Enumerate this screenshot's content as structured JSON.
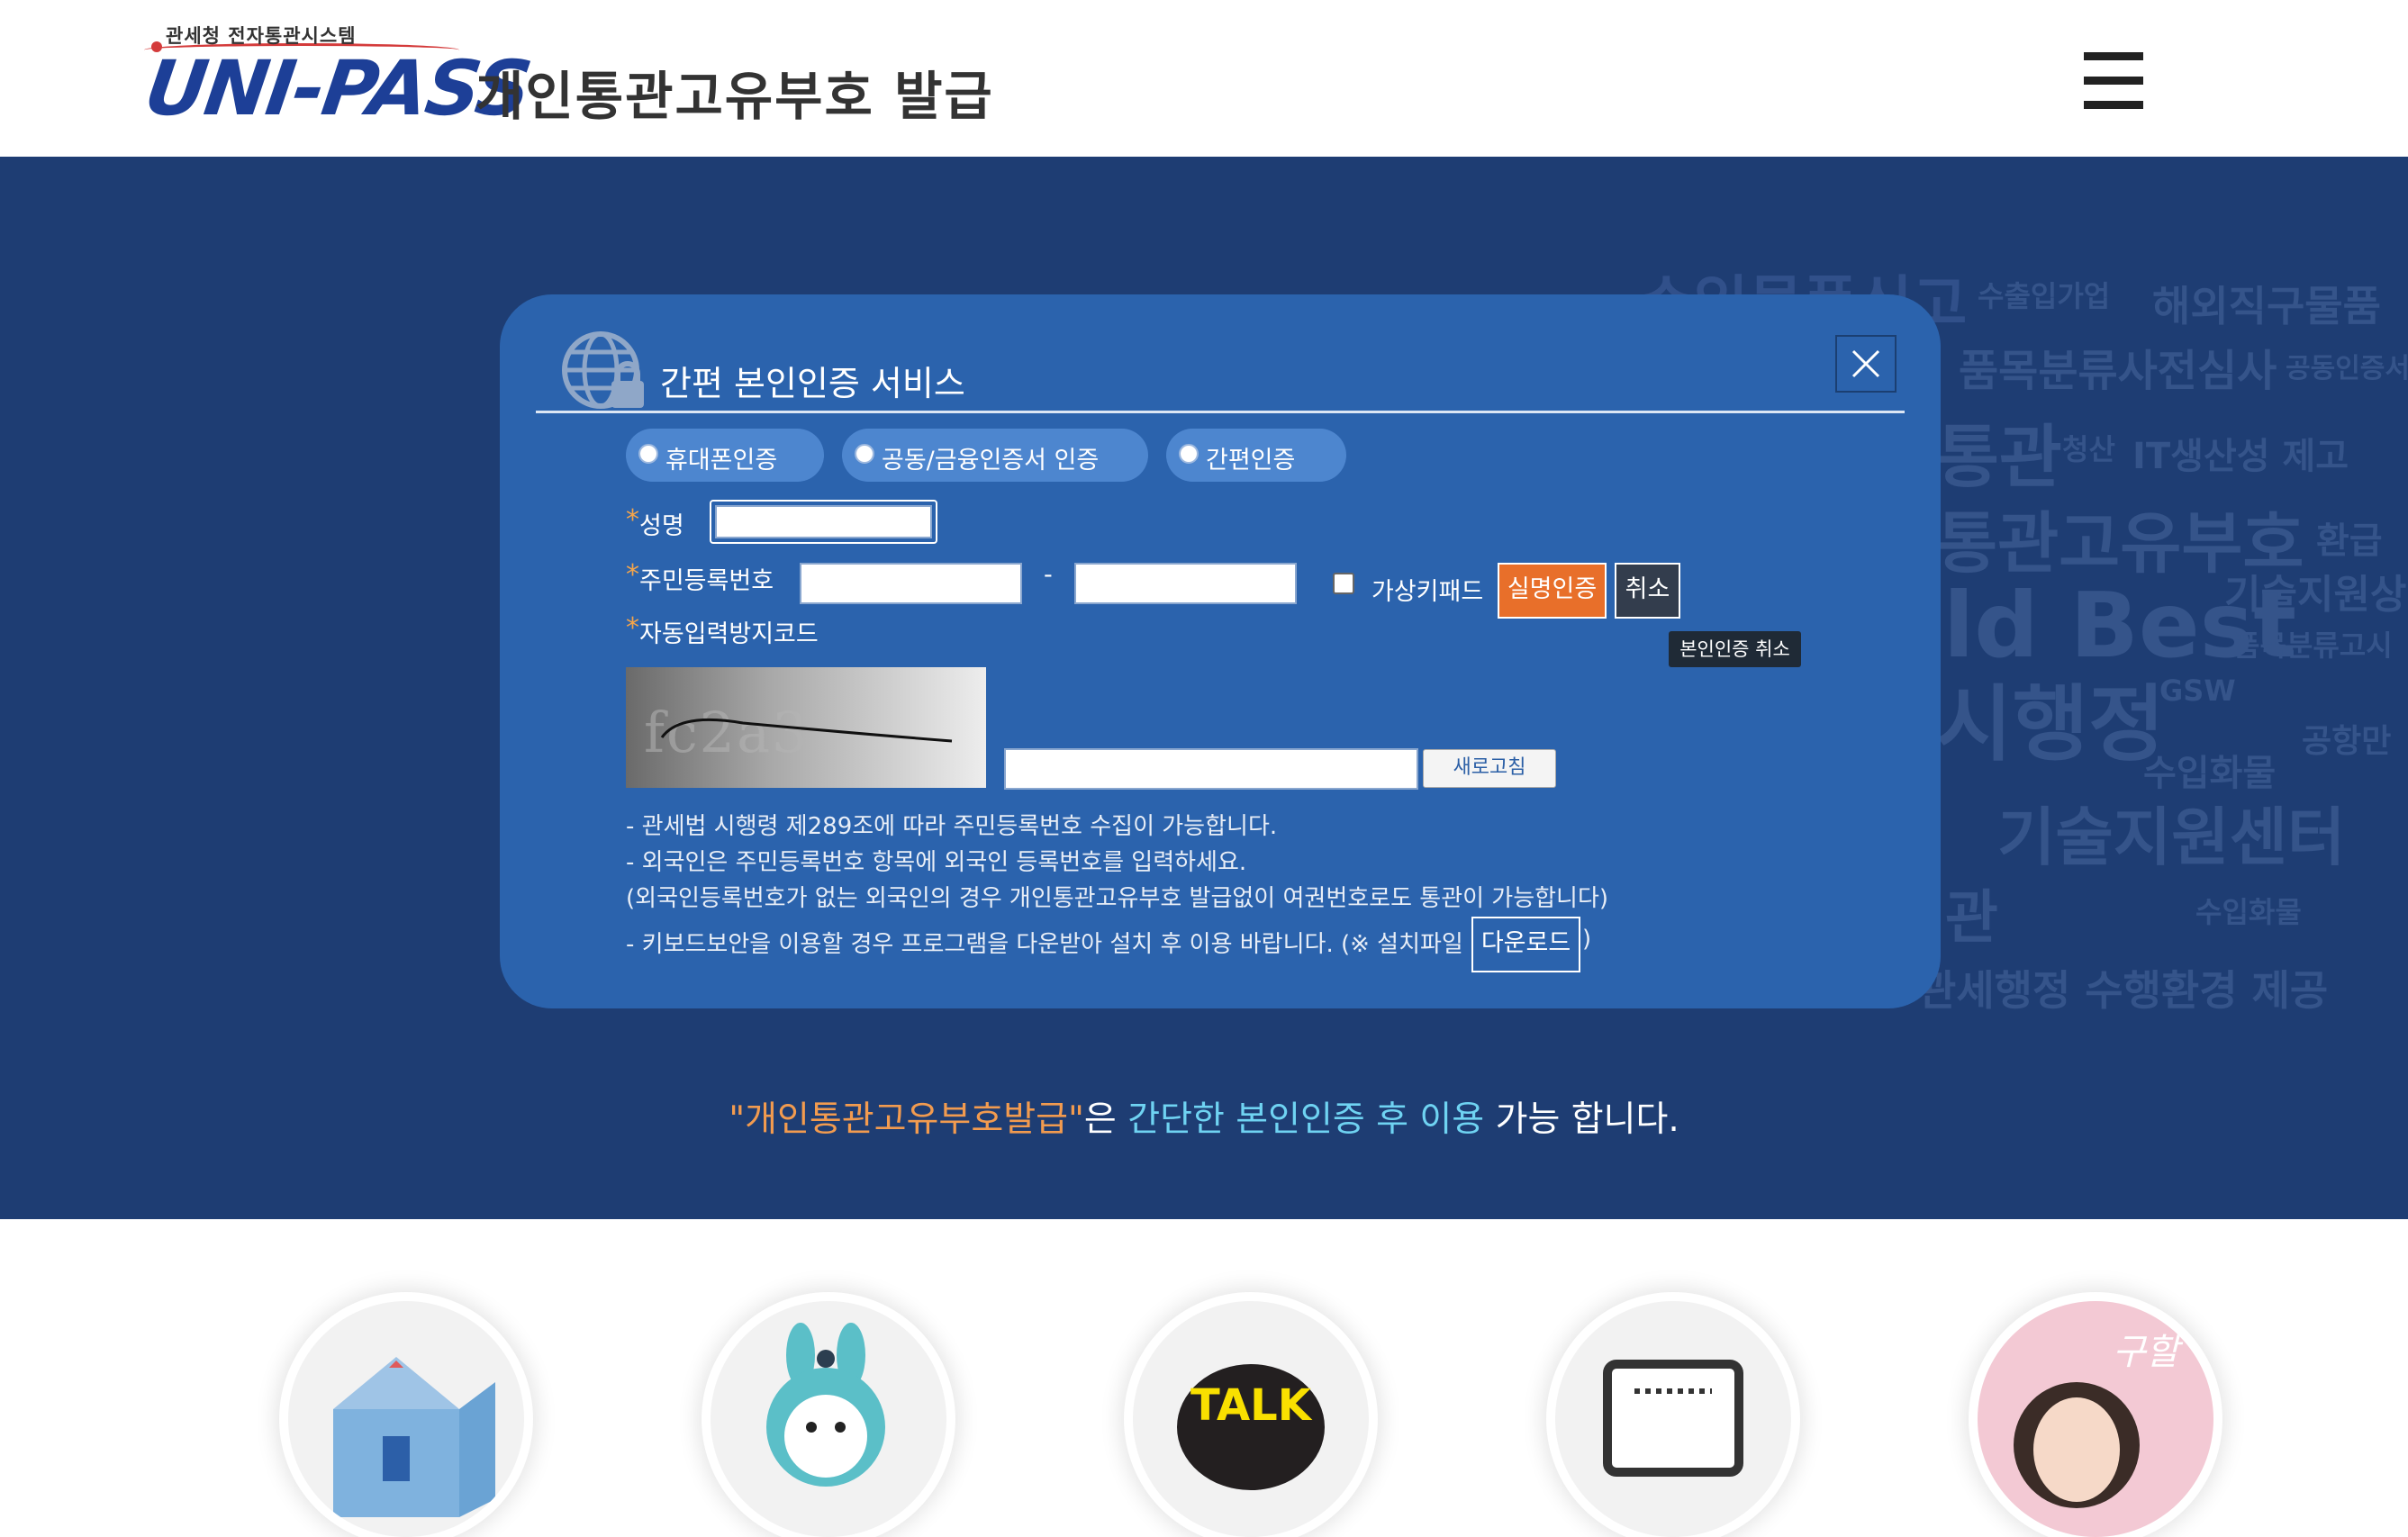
{
  "header": {
    "logo_sub": "관세청 전자통관시스템",
    "logo_text": "UNI-PASS",
    "title": "개인통관고유부호 발급",
    "menu_icon": "hamburger-menu-icon"
  },
  "background_words": [
    "수입물품신고",
    "수출입가업",
    "해외직구물품",
    "품목분류사전심사",
    "공동인증서",
    "통관",
    "청산",
    "IT생산성 제고",
    "통관고유부호",
    "환급",
    "기술지원상",
    "ld Best",
    "품목분류고시",
    "시행정",
    "GSW",
    "수입화물",
    "공항만",
    "기술지원센터",
    "수입화물",
    "관",
    "관세행정 수행환경 제공"
  ],
  "modal": {
    "icon": "globe-lock-icon",
    "title": "간편 본인인증 서비스",
    "close_icon": "close-icon",
    "auth_options": [
      "휴대폰인증",
      "공동/금융인증서 인증",
      "간편인증"
    ],
    "name_label": "성명",
    "rrn_label": "주민등록번호",
    "rrn_separator": "-",
    "virtual_keypad_label": "가상키패드",
    "verify_button": "실명인증",
    "cancel_button": "취소",
    "cancel_tooltip": "본인인증 취소",
    "captcha_label": "자동입력방지코드",
    "captcha_text": "fc2a3",
    "refresh_button": "새로고침",
    "notes": [
      "- 관세법 시행령 제289조에 따라 주민등록번호 수집이 가능합니다.",
      "- 외국인은 주민등록번호 항목에 외국인 등록번호를 입력하세요.",
      "(외국인등록번호가 없는 외국인의 경우 개인통관고유부호 발급없이 여권번호로도 통관이 가능합니다)",
      "- 키보드보안을 이용할 경우 프로그램을 다운받아 설치 후 이용 바랍니다. (※ 설치파일"
    ],
    "download_button": "다운로드",
    "notes_end": ")"
  },
  "tagline": {
    "part1": "\"개인통관고유부호발급\"",
    "part2": "은 ",
    "part3": "간단한 본인인증 후 이용",
    "part4": " 가능 합니다."
  },
  "services": [
    "house-icon",
    "rabbit-character-icon",
    "kakao-talk-icon",
    "chat-window-icon",
    "consultant-photo"
  ],
  "colors": {
    "hero_bg": "#1e3d73",
    "modal_bg": "#2b63ad",
    "accent_orange": "#e86f2a",
    "tagline_orange": "#f29b4f",
    "tagline_cyan": "#6fd3f2"
  }
}
